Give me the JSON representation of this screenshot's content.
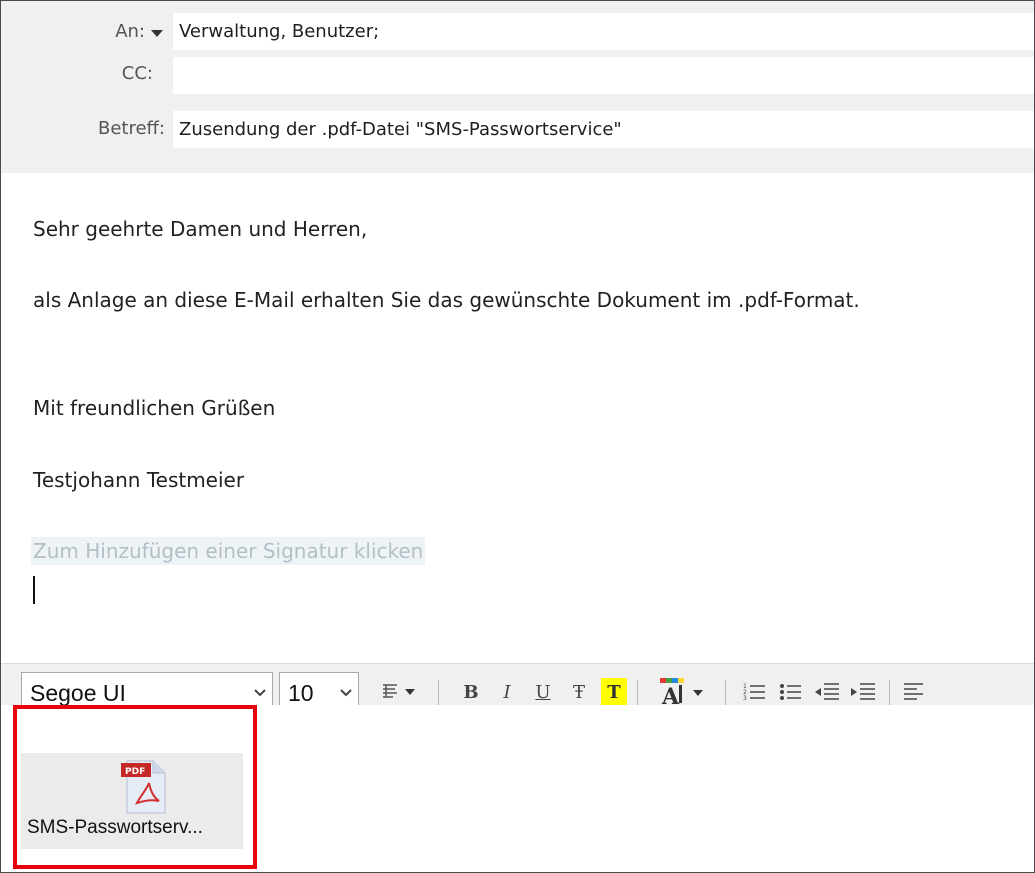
{
  "header": {
    "to_label": "An:",
    "to_value": "Verwaltung, Benutzer;",
    "cc_label": "CC:",
    "cc_value": "",
    "subject_label": "Betreff:",
    "subject_value": "Zusendung der .pdf-Datei \"SMS-Passwortservice\""
  },
  "body": {
    "greeting": "Sehr geehrte Damen und Herren,",
    "text": "als Anlage an diese E-Mail erhalten Sie das gewünschte Dokument im .pdf-Format.",
    "closing": "Mit freundlichen Grüßen",
    "name": "Testjohann Testmeier",
    "signature_hint": "Zum Hinzufügen einer Signatur klicken"
  },
  "toolbar": {
    "font_name": "Segoe UI",
    "font_size": "10",
    "bold_label": "B",
    "italic_label": "I",
    "underline_label": "U",
    "strike_label": "Ŧ",
    "highlight_label": "T",
    "icons": [
      "paragraph-format-icon",
      "bold-icon",
      "italic-icon",
      "underline-icon",
      "strikethrough-icon",
      "highlight-icon",
      "font-color-icon",
      "numbered-list-icon",
      "bullet-list-icon",
      "decrease-indent-icon",
      "increase-indent-icon",
      "align-icon"
    ],
    "highlight_color": "#ffff00"
  },
  "attachment": {
    "icon_badge": "PDF",
    "file_name": "SMS-Passwortserv...",
    "highlight_color": "#e8000b"
  }
}
